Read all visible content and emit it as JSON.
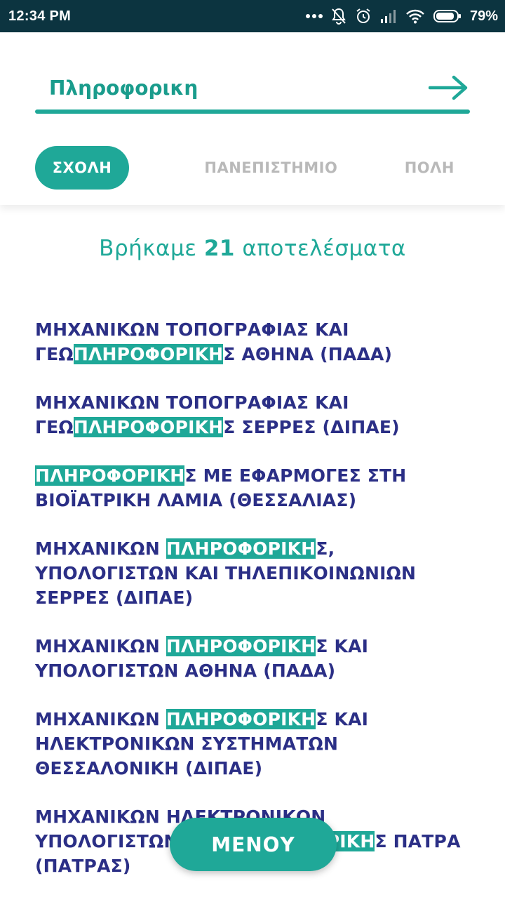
{
  "status_bar": {
    "time": "12:34 PM",
    "battery": "79%",
    "icons": [
      "more-dots-icon",
      "notifications-off-icon",
      "alarm-icon",
      "signal-icon",
      "wifi-icon",
      "battery-icon"
    ]
  },
  "search": {
    "value": "Πληροφορικη",
    "go_icon": "arrow-right-icon"
  },
  "filters": [
    {
      "label": "ΣΧΟΛΗ",
      "active": true
    },
    {
      "label": "ΠΑΝΕΠΙΣΤΗΜΙΟ",
      "active": false
    },
    {
      "label": "ΠΟΛΗ",
      "active": false
    }
  ],
  "results_summary": {
    "prefix": "Βρήκαμε",
    "count": "21",
    "suffix": "αποτελέσματα"
  },
  "results": [
    {
      "before": "ΜΗΧΑΝΙΚΩΝ ΤΟΠΟΓΡΑΦΙΑΣ ΚΑΙ ΓΕΩ",
      "match": "ΠΛΗΡΟΦΟΡΙΚΗ",
      "after": "Σ ΑΘΗΝΑ (ΠΑΔΑ)"
    },
    {
      "before": "ΜΗΧΑΝΙΚΩΝ ΤΟΠΟΓΡΑΦΙΑΣ ΚΑΙ ΓΕΩ",
      "match": "ΠΛΗΡΟΦΟΡΙΚΗ",
      "after": "Σ ΣΕΡΡΕΣ (ΔΙΠΑΕ)"
    },
    {
      "before": "",
      "match": "ΠΛΗΡΟΦΟΡΙΚΗ",
      "after": "Σ ΜΕ ΕΦΑΡΜΟΓΕΣ ΣΤΗ ΒΙΟΪΑΤΡΙΚΗ ΛΑΜΙΑ (ΘΕΣΣΑΛΙΑΣ)"
    },
    {
      "before": "ΜΗΧΑΝΙΚΩΝ ",
      "match": "ΠΛΗΡΟΦΟΡΙΚΗ",
      "after": "Σ, ΥΠΟΛΟΓΙΣΤΩΝ ΚΑΙ ΤΗΛΕΠΙΚΟΙΝΩΝΙΩΝ ΣΕΡΡΕΣ (ΔΙΠΑΕ)"
    },
    {
      "before": "ΜΗΧΑΝΙΚΩΝ ",
      "match": "ΠΛΗΡΟΦΟΡΙΚΗ",
      "after": "Σ ΚΑΙ ΥΠΟΛΟΓΙΣΤΩΝ ΑΘΗΝΑ (ΠΑΔΑ)"
    },
    {
      "before": "ΜΗΧΑΝΙΚΩΝ ",
      "match": "ΠΛΗΡΟΦΟΡΙΚΗ",
      "after": "Σ ΚΑΙ ΗΛΕΚΤΡΟΝΙΚΩΝ ΣΥΣΤΗΜΑΤΩΝ ΘΕΣΣΑΛΟΝΙΚΗ (ΔΙΠΑΕ)"
    },
    {
      "before": "ΜΗΧΑΝΙΚΩΝ ΗΛΕΚΤΡΟΝΙΚΩΝ ΥΠΟΛΟΓΙΣΤΩΝ ΚΑΙ ",
      "match": "ΠΛΗΡΟΦΟΡΙΚΗ",
      "after": "Σ ΠΑΤΡΑ (ΠΑΤΡΑΣ)"
    }
  ],
  "menu_button": {
    "label": "ΜΕΝΟΥ"
  },
  "colors": {
    "accent": "#1fa898",
    "results_text": "#2b2f86",
    "status_bar": "#0c3440",
    "inactive_filter": "#b9b9b9"
  }
}
